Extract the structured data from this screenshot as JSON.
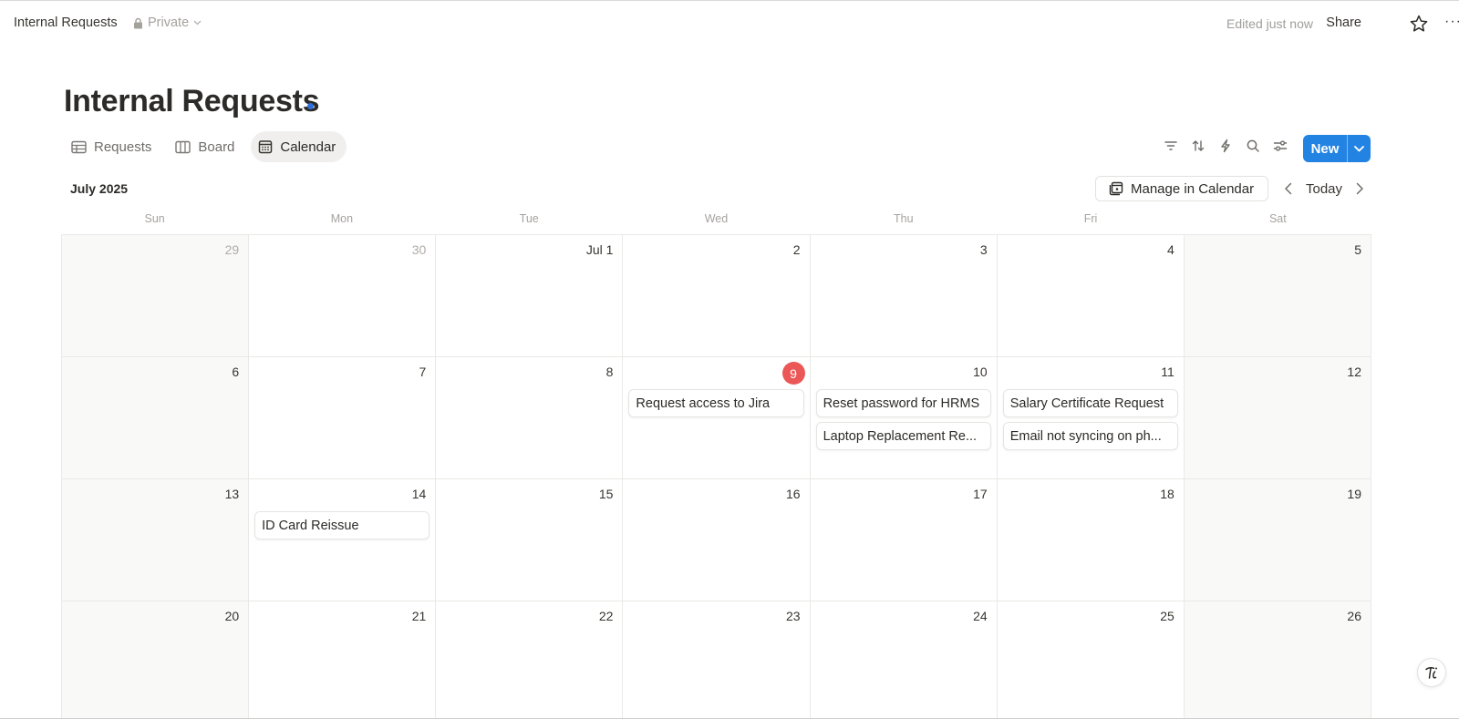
{
  "topbar": {
    "breadcrumb": "Internal Requests",
    "privacy": "Private",
    "edited": "Edited just now",
    "share": "Share",
    "more": "···"
  },
  "page": {
    "title": "Internal Requests"
  },
  "views": [
    {
      "label": "Requests",
      "icon": "table-icon",
      "active": false
    },
    {
      "label": "Board",
      "icon": "board-icon",
      "active": false
    },
    {
      "label": "Calendar",
      "icon": "calendar-icon",
      "active": true
    }
  ],
  "toolbar": {
    "icons": [
      "filter-icon",
      "sort-icon",
      "automation-icon",
      "search-icon",
      "settings-icon"
    ],
    "new_label": "New"
  },
  "calendar": {
    "month_label": "July 2025",
    "manage_label": "Manage in Calendar",
    "today_label": "Today",
    "weekdays": [
      "Sun",
      "Mon",
      "Tue",
      "Wed",
      "Thu",
      "Fri",
      "Sat"
    ],
    "weeks": [
      [
        {
          "day": "29",
          "muted": true,
          "weekend": true,
          "events": []
        },
        {
          "day": "30",
          "muted": true,
          "events": []
        },
        {
          "day": "Jul 1",
          "events": []
        },
        {
          "day": "2",
          "events": []
        },
        {
          "day": "3",
          "events": []
        },
        {
          "day": "4",
          "events": []
        },
        {
          "day": "5",
          "weekend": true,
          "events": []
        }
      ],
      [
        {
          "day": "6",
          "weekend": true,
          "events": []
        },
        {
          "day": "7",
          "events": []
        },
        {
          "day": "8",
          "events": []
        },
        {
          "day": "9",
          "today": true,
          "events": [
            "Request access to Jira"
          ]
        },
        {
          "day": "10",
          "events": [
            "Reset password for HRMS",
            "Laptop Replacement Re..."
          ]
        },
        {
          "day": "11",
          "events": [
            "Salary Certificate Request",
            "Email not syncing on ph..."
          ]
        },
        {
          "day": "12",
          "weekend": true,
          "events": []
        }
      ],
      [
        {
          "day": "13",
          "weekend": true,
          "events": []
        },
        {
          "day": "14",
          "events": [
            "ID Card Reissue"
          ]
        },
        {
          "day": "15",
          "events": []
        },
        {
          "day": "16",
          "events": []
        },
        {
          "day": "17",
          "events": []
        },
        {
          "day": "18",
          "events": []
        },
        {
          "day": "19",
          "weekend": true,
          "events": []
        }
      ],
      [
        {
          "day": "20",
          "weekend": true,
          "events": []
        },
        {
          "day": "21",
          "events": []
        },
        {
          "day": "22",
          "events": []
        },
        {
          "day": "23",
          "events": []
        },
        {
          "day": "24",
          "events": []
        },
        {
          "day": "25",
          "events": []
        },
        {
          "day": "26",
          "weekend": true,
          "events": []
        }
      ]
    ]
  },
  "colors": {
    "accent": "#2383e2",
    "today": "#eb5757",
    "weekend_bg": "#f9f9f8"
  }
}
